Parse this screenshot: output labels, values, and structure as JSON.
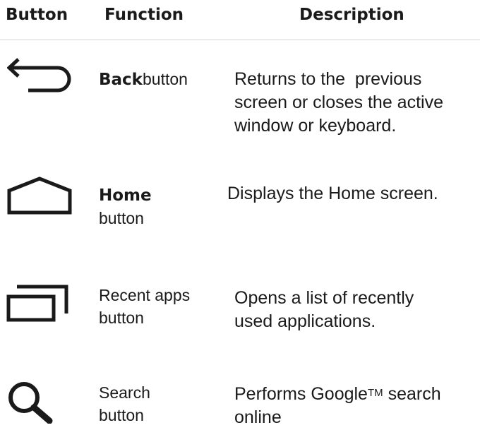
{
  "header": {
    "col_button": "Button",
    "col_function": "Function",
    "col_description": "Description"
  },
  "rows": [
    {
      "icon": "back-arrow-icon",
      "function_bold": "Back",
      "function_rest": "button",
      "description_lines": [
        "Returns to the  previous",
        "screen or closes the active",
        "window or keyboard."
      ]
    },
    {
      "icon": "home-house-icon",
      "function_bold": "Home",
      "function_rest": "button",
      "description_lines": [
        "Displays the Home screen."
      ]
    },
    {
      "icon": "recent-apps-icon",
      "function_line1": "Recent apps",
      "function_line2": "button",
      "description_lines": [
        "Opens a list of recently",
        "used applications."
      ]
    },
    {
      "icon": "search-magnifier-icon",
      "function_line1": "Search",
      "function_line2": "button",
      "description_line1_before": "Performs Google",
      "description_line1_sup": "TM",
      "description_line1_after": " search",
      "description_line2": "online"
    }
  ]
}
